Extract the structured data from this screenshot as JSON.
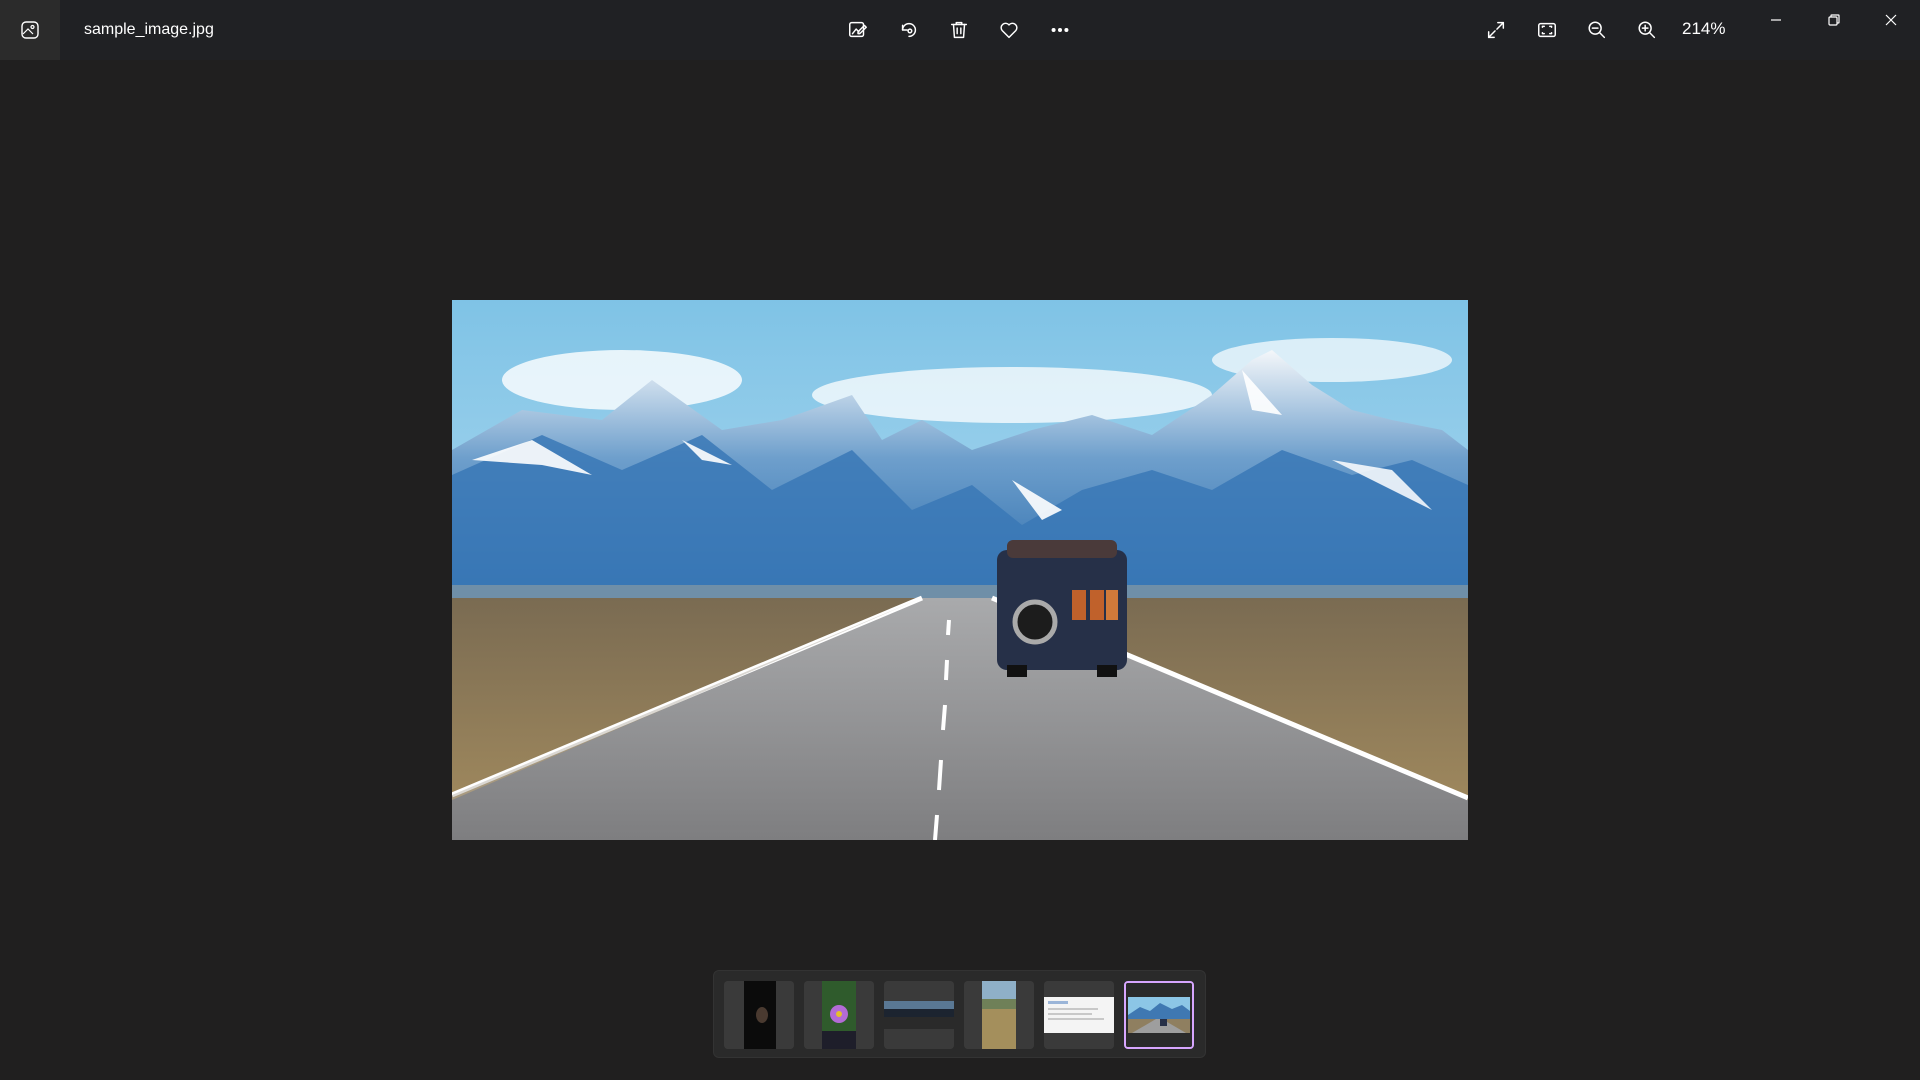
{
  "window": {
    "file_name": "sample_image.jpg",
    "zoom_level": "214%"
  },
  "toolbar": {
    "icons": [
      "edit-image-icon",
      "rotate-icon",
      "delete-icon",
      "favorite-heart-icon",
      "more-options-icon"
    ]
  },
  "view_controls": {
    "icons": [
      "fullscreen-icon",
      "fit-to-window-icon",
      "zoom-out-icon",
      "zoom-in-icon"
    ]
  },
  "window_controls": {
    "icons": [
      "minimize-icon",
      "restore-icon",
      "close-icon"
    ]
  },
  "filmstrip": {
    "thumbnails": [
      {
        "name": "thumb-dark-portrait",
        "selected": false
      },
      {
        "name": "thumb-purple-flower",
        "selected": false
      },
      {
        "name": "thumb-night-road",
        "selected": false
      },
      {
        "name": "thumb-grass-field",
        "selected": false
      },
      {
        "name": "thumb-document-screenshot",
        "selected": false
      },
      {
        "name": "thumb-mountain-road",
        "selected": true
      }
    ],
    "selected_border_color": "#d7a6ff"
  },
  "colors": {
    "titlebar_bg": "#202124",
    "viewer_bg": "#201f1f",
    "filmstrip_bg": "#2a2a2a"
  }
}
